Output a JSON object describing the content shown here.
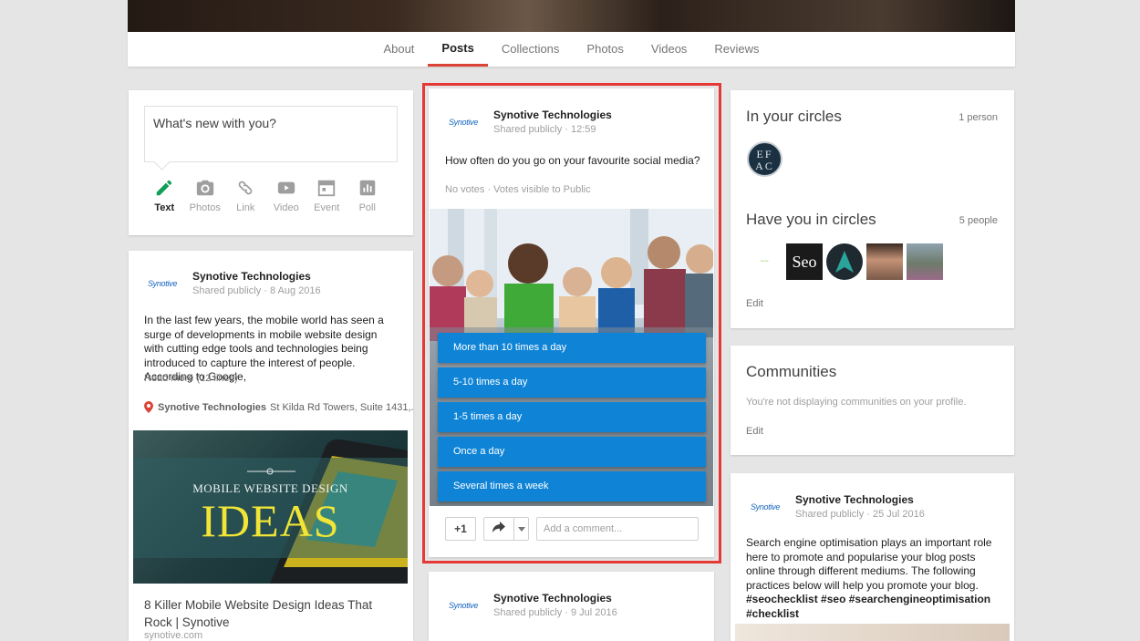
{
  "nav": {
    "tabs": [
      {
        "label": "About"
      },
      {
        "label": "Posts",
        "active": true
      },
      {
        "label": "Collections"
      },
      {
        "label": "Photos"
      },
      {
        "label": "Videos"
      },
      {
        "label": "Reviews"
      }
    ]
  },
  "composer": {
    "placeholder": "What's new with you?",
    "tools": [
      {
        "label": "Text",
        "icon": "pencil-icon"
      },
      {
        "label": "Photos",
        "icon": "camera-icon"
      },
      {
        "label": "Link",
        "icon": "link-icon"
      },
      {
        "label": "Video",
        "icon": "video-icon"
      },
      {
        "label": "Event",
        "icon": "calendar-icon"
      },
      {
        "label": "Poll",
        "icon": "poll-icon"
      }
    ]
  },
  "left_post": {
    "logo": "Synotive",
    "author": "Synotive Technologies",
    "meta": "Shared publicly  ·  8 Aug 2016",
    "body": "In the last few years, the mobile world has seen a surge of developments in mobile website design with cutting edge tools and technologies being introduced to capture the interest of people. According to Google,",
    "read_more": "Read more (12 lines)",
    "location_name": "Synotive Technologies",
    "location_address": "St Kilda Rd Towers, Suite 1431,...",
    "image_line1": "MOBILE WEBSITE DESIGN",
    "image_line2": "IDEAS",
    "link_title": "8 Killer Mobile Website Design Ideas That Rock | Synotive",
    "link_domain": "synotive.com"
  },
  "poll_post": {
    "logo": "Synotive",
    "author": "Synotive Technologies",
    "meta": "Shared publicly  ·  12:59",
    "question": "How often do you go on your favourite social media?",
    "votes": "No votes  ·  Votes visible to Public",
    "options": [
      "More than 10 times a day",
      "5-10 times a day",
      "1-5 times a day",
      "Once a day",
      "Several times a week"
    ],
    "plus_one": "+1",
    "comment_placeholder": "Add a comment..."
  },
  "next_post": {
    "logo": "Synotive",
    "author": "Synotive Technologies",
    "meta": "Shared publicly  ·  9 Jul 2016"
  },
  "circles": {
    "in_title": "In your circles",
    "in_count": "1 person",
    "avatar_text": "EFAC",
    "have_title": "Have you in circles",
    "have_count": "5 people",
    "avatar_labels": [
      "Seo"
    ],
    "edit": "Edit"
  },
  "communities": {
    "title": "Communities",
    "text": "You're not displaying communities on your profile.",
    "edit": "Edit"
  },
  "right_post": {
    "logo": "Synotive",
    "author": "Synotive Technologies",
    "meta": "Shared publicly  ·  25 Jul 2016",
    "body": "Search engine optimisation plays an important role here to promote and popularise your blog posts online through different mediums. The following practices below will help you promote your blog.",
    "hashtags": "#seochecklist #seo #searchengineoptimisation #checklist"
  },
  "colors": {
    "accent_red": "#db4437",
    "poll_blue": "#0f84d6",
    "highlight": "#e53935"
  }
}
